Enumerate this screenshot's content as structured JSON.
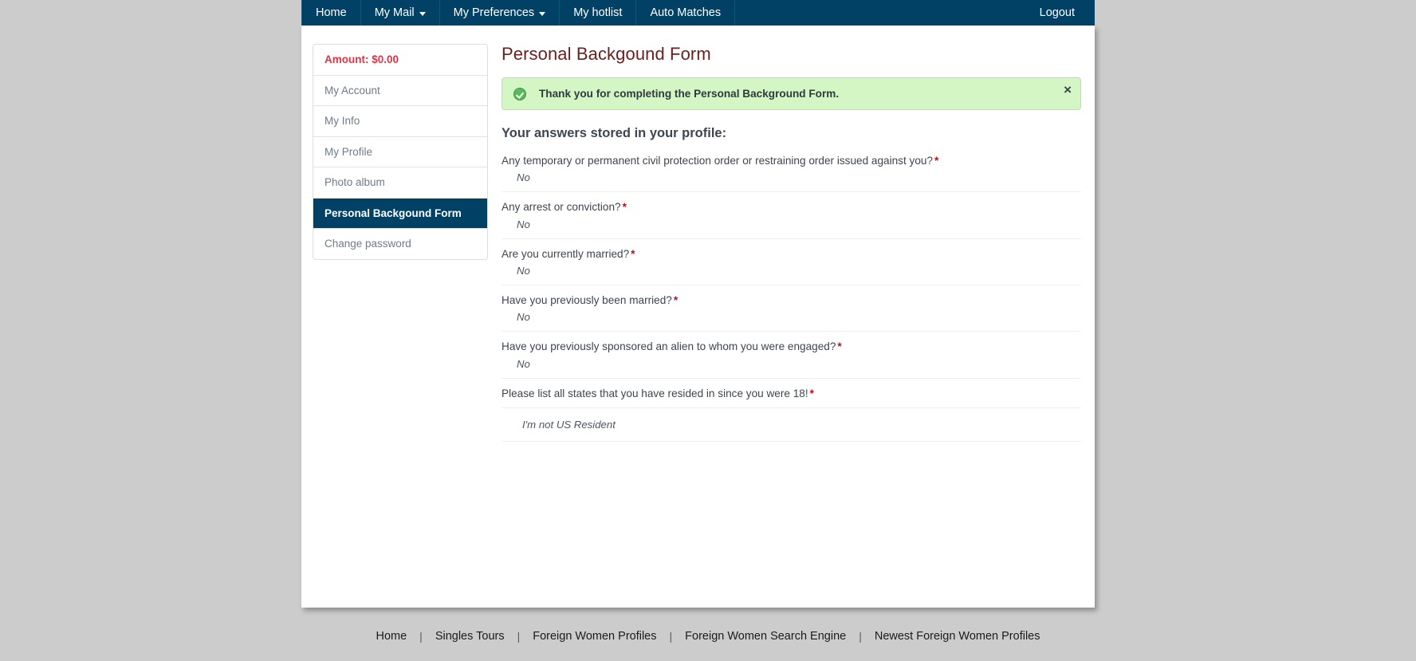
{
  "navbar": {
    "background": "#004165",
    "items": [
      {
        "label": "Home",
        "has_caret": false
      },
      {
        "label": "My Mail",
        "has_caret": true
      },
      {
        "label": "My Preferences",
        "has_caret": true
      },
      {
        "label": "My hotlist",
        "has_caret": false
      },
      {
        "label": "Auto Matches",
        "has_caret": false
      }
    ],
    "logout_label": "Logout"
  },
  "sidebar": {
    "amount_label": "Amount: $0.00",
    "amount_color": "#dc3545",
    "active_color": "#004165",
    "items": [
      {
        "label": "My Account",
        "active": false
      },
      {
        "label": "My Info",
        "active": false
      },
      {
        "label": "My Profile",
        "active": false
      },
      {
        "label": "Photo album",
        "active": false
      },
      {
        "label": "Personal Backgound Form",
        "active": true
      },
      {
        "label": "Change password",
        "active": false
      }
    ]
  },
  "main": {
    "page_title": "Personal Backgound Form",
    "title_color": "#6b2020",
    "alert": {
      "icon": "check-circle-icon",
      "message": "Thank you for completing the Personal Background Form.",
      "close_label": "×",
      "background": "#d4f5c4",
      "border": "#b9e3a4"
    },
    "answers_heading": "Your answers stored in your profile:",
    "required_marker": "*",
    "questions": [
      {
        "question": "Any temporary or permanent civil protection order or restraining order issued against you?",
        "required": true,
        "answer": "No",
        "answer_standalone": false
      },
      {
        "question": "Any arrest or conviction?",
        "required": true,
        "answer": "No",
        "answer_standalone": false
      },
      {
        "question": "Are you currently married?",
        "required": true,
        "answer": "No",
        "answer_standalone": false
      },
      {
        "question": "Have you previously been married?",
        "required": true,
        "answer": "No",
        "answer_standalone": false
      },
      {
        "question": "Have you previously sponsored an alien to whom you were engaged?",
        "required": true,
        "answer": "No",
        "answer_standalone": false
      },
      {
        "question": "Please list all states that you have resided in since you were 18!",
        "required": true,
        "answer": "I'm not US Resident",
        "answer_standalone": true
      }
    ]
  },
  "footer": {
    "links": [
      "Home",
      "Singles Tours",
      "Foreign Women Profiles",
      "Foreign Women Search Engine",
      "Newest Foreign Women Profiles"
    ],
    "separator": "|"
  }
}
